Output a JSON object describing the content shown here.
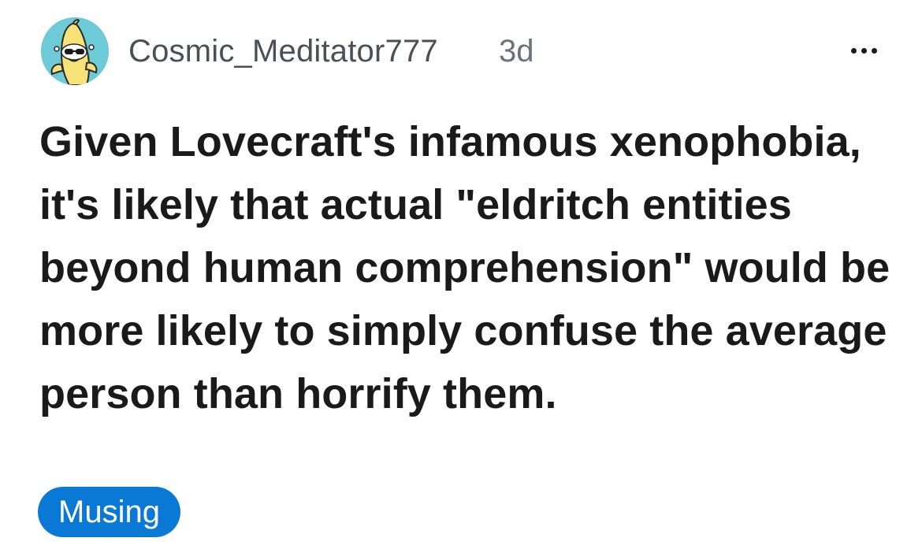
{
  "post": {
    "author": "Cosmic_Meditator777",
    "timestamp": "3d",
    "title": "Given Lovecraft's infamous xenophobia, it's likely that actual \"eldritch entities beyond human comprehension\" would be more likely to simply confuse the average person than horrify them.",
    "flair": "Musing"
  },
  "icons": {
    "avatar": "banana-avatar-icon",
    "more": "more-options-icon"
  },
  "colors": {
    "avatar_bg": "#6ccbd6",
    "flair_bg": "#0a79d6",
    "flair_text": "#ffffff",
    "title_text": "#1a1a1b",
    "meta_text": "#4a5156"
  }
}
